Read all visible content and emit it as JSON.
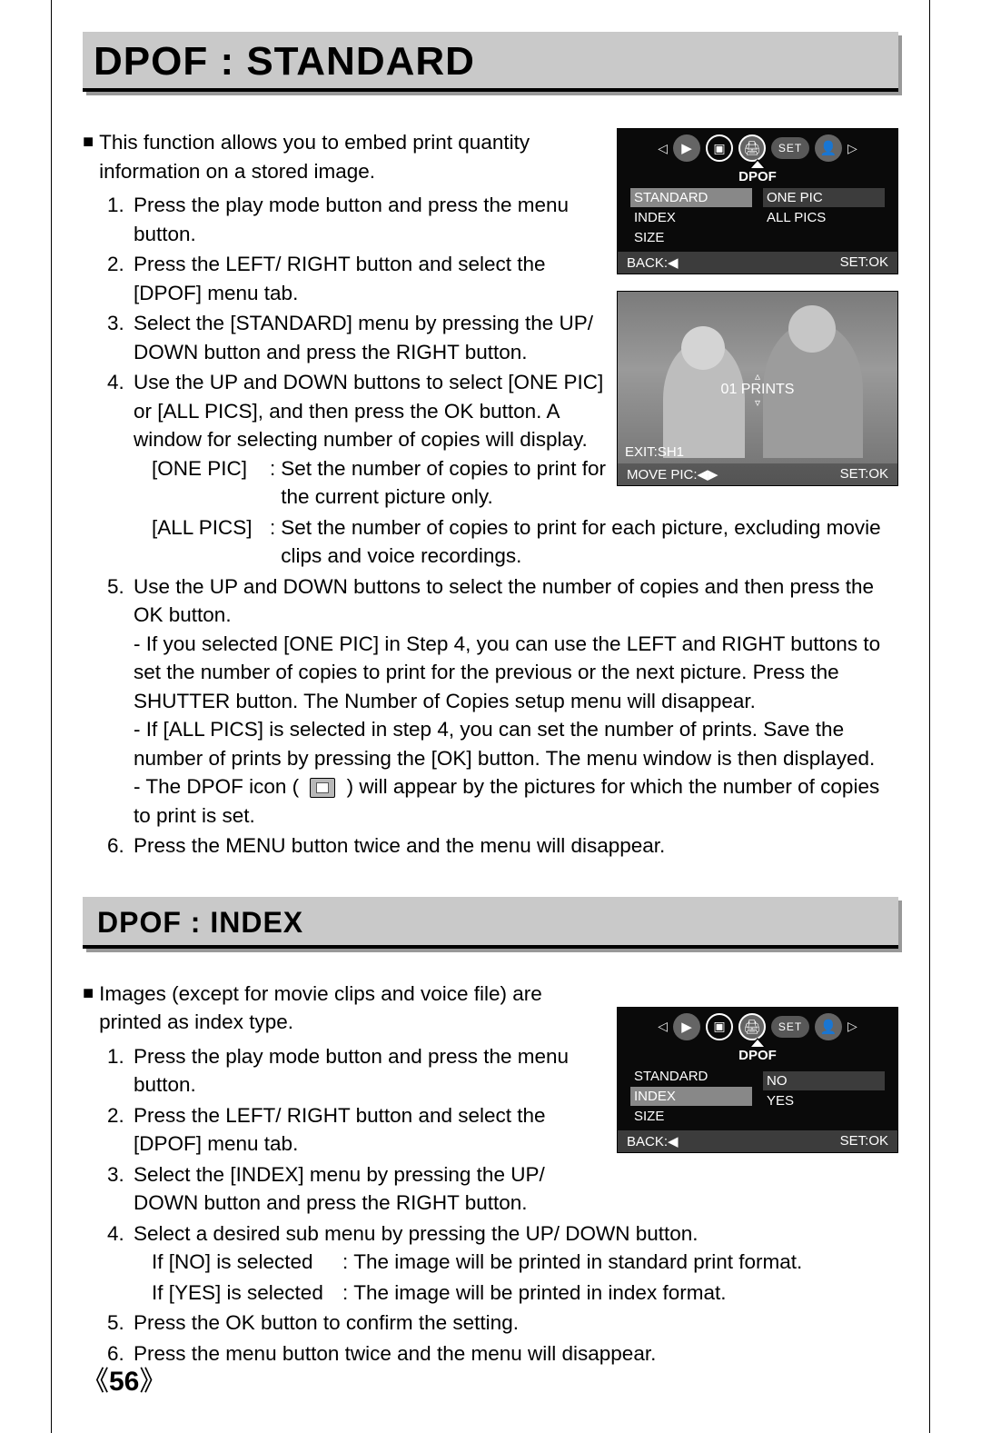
{
  "page_number": "56",
  "section1": {
    "title": "DPOF : STANDARD",
    "intro": "This function allows you to embed print quantity information on a stored image.",
    "steps": [
      "Press the play mode button and press the menu button.",
      "Press the LEFT/ RIGHT button and select the [DPOF] menu tab.",
      "Select the [STANDARD] menu by pressing the UP/ DOWN button and press the RIGHT button.",
      "Use the UP and DOWN buttons to select [ONE PIC] or [ALL PICS], and then press the OK button. A window for selecting number of copies will display."
    ],
    "defs": {
      "one_pic_label": "[ONE PIC]",
      "one_pic_desc": "Set the number of copies to print for the current picture only.",
      "all_pics_label": "[ALL PICS]",
      "all_pics_desc": "Set the number of copies to print for each picture, excluding movie clips and voice recordings."
    },
    "step5": "Use the UP and DOWN buttons to select the number of copies and then press the OK button.",
    "step5_sub1": "If you selected [ONE PIC] in Step 4, you can use the LEFT and RIGHT buttons to set the number of copies to print for the previous or the next picture. Press the SHUTTER button. The Number of Copies setup menu will disappear.",
    "step5_sub2": "If [ALL PICS] is selected in step 4, you can set the number of prints. Save the number of prints by pressing the [OK] button. The menu window is then displayed.",
    "step5_sub3a": "The DPOF icon (",
    "step5_sub3b": ") will appear by the pictures for which the number of copies to print is set.",
    "step6": "Press the MENU button twice and the menu will disappear."
  },
  "section2": {
    "title": "DPOF : INDEX",
    "intro": "Images (except for movie clips and voice file) are printed as index type.",
    "steps": [
      "Press the play mode button and press the menu button.",
      "Press the LEFT/ RIGHT button and select the [DPOF] menu tab.",
      "Select the [INDEX] menu by pressing the UP/ DOWN button and press the RIGHT button.",
      "Select a desired sub menu by pressing the UP/ DOWN button."
    ],
    "defs": {
      "no_label": "If [NO] is selected",
      "no_desc": "The image will be printed in standard print format.",
      "yes_label": "If [YES] is selected",
      "yes_desc": "The image will be printed in index format."
    },
    "step5": "Press the OK button to confirm the setting.",
    "step6": "Press the menu button twice and the menu will disappear."
  },
  "lcd1": {
    "header": "DPOF",
    "left": [
      "STANDARD",
      "INDEX",
      "SIZE"
    ],
    "right": [
      "ONE PIC",
      "ALL PICS"
    ],
    "back": "BACK:◀",
    "set": "SET:OK",
    "iconbar_set": "SET"
  },
  "photo": {
    "prints": "01 PRINTS",
    "exit": "EXIT:SH1",
    "move": "MOVE PIC:◀▶",
    "set": "SET:OK"
  },
  "lcd2": {
    "header": "DPOF",
    "left": [
      "STANDARD",
      "INDEX",
      "SIZE"
    ],
    "right": [
      "",
      "NO",
      "YES"
    ],
    "back": "BACK:◀",
    "set": "SET:OK",
    "iconbar_set": "SET"
  }
}
